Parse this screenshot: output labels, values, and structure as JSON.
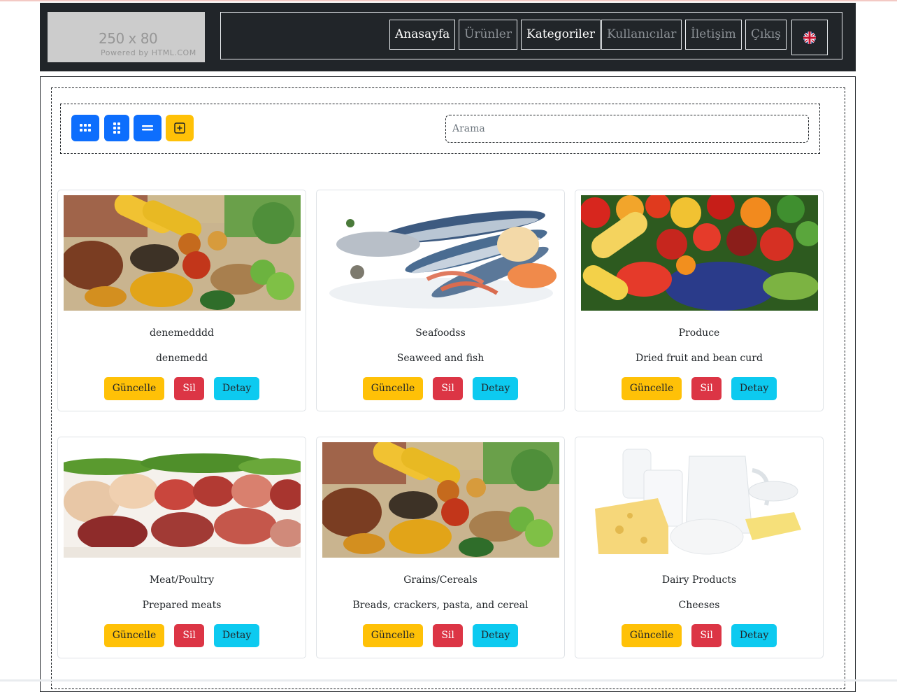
{
  "header": {
    "logo_size": "250 x 80",
    "logo_powered": "Powered by HTML.COM",
    "nav": [
      {
        "label": "Anasayfa"
      },
      {
        "label": "Ürünler"
      },
      {
        "label": "Kategoriler"
      },
      {
        "label": "Kullanıcılar"
      },
      {
        "label": "İletişim"
      },
      {
        "label": "Çıkış"
      }
    ],
    "language_icon": "uk-flag-icon"
  },
  "toolbar": {
    "buttons": [
      {
        "icon": "grid-three-icon"
      },
      {
        "icon": "grid-two-icon"
      },
      {
        "icon": "list-icon"
      },
      {
        "icon": "add-square-icon"
      }
    ],
    "search_placeholder": "Arama"
  },
  "actions": {
    "update": "Güncelle",
    "delete": "Sil",
    "detail": "Detay"
  },
  "categories": [
    {
      "name": "denemedddd",
      "description": "denemedd",
      "image": "spices-grains"
    },
    {
      "name": "Seafoodss",
      "description": "Seaweed and fish",
      "image": "seafood"
    },
    {
      "name": "Produce",
      "description": "Dried fruit and bean curd",
      "image": "vegetables"
    },
    {
      "name": "Meat/Poultry",
      "description": "Prepared meats",
      "image": "meats"
    },
    {
      "name": "Grains/Cereals",
      "description": "Breads, crackers, pasta, and cereal",
      "image": "spices-grains"
    },
    {
      "name": "Dairy Products",
      "description": "Cheeses",
      "image": "dairy"
    }
  ],
  "colors": {
    "primary": "#0d6efd",
    "warning": "#ffc107",
    "danger": "#dc3545",
    "info": "#0dcaf0",
    "header_bg": "#212529"
  }
}
